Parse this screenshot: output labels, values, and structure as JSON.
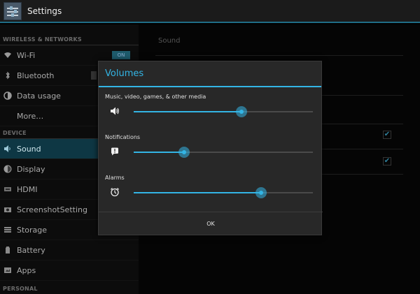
{
  "actionbar": {
    "title": "Settings",
    "icon": "settings-app-icon"
  },
  "sidebar": {
    "sections": [
      {
        "header": "WIRELESS & NETWORKS"
      },
      {
        "header": "DEVICE"
      },
      {
        "header": "PERSONAL"
      }
    ],
    "items": [
      {
        "label": "Wi-Fi",
        "icon": "wifi-icon",
        "toggle": "ON"
      },
      {
        "label": "Bluetooth",
        "icon": "bluetooth-icon",
        "toggle": ""
      },
      {
        "label": "Data usage",
        "icon": "data-usage-icon"
      },
      {
        "label": "More…"
      },
      {
        "label": "Sound",
        "icon": "speaker-icon",
        "active": true
      },
      {
        "label": "Display",
        "icon": "display-icon"
      },
      {
        "label": "HDMI",
        "icon": "hdmi-icon"
      },
      {
        "label": "ScreenshotSetting",
        "icon": "camera-icon"
      },
      {
        "label": "Storage",
        "icon": "storage-icon"
      },
      {
        "label": "Battery",
        "icon": "battery-icon"
      },
      {
        "label": "Apps",
        "icon": "apps-icon"
      }
    ]
  },
  "content": {
    "category": "Sound"
  },
  "dialog": {
    "title": "Volumes",
    "volumes": [
      {
        "label": "Music, video, games, & other media",
        "icon": "speaker-icon",
        "level": 0.6
      },
      {
        "label": "Notifications",
        "icon": "notification-icon",
        "level": 0.28
      },
      {
        "label": "Alarms",
        "icon": "alarm-clock-icon",
        "level": 0.71
      }
    ],
    "ok_label": "OK"
  },
  "colors": {
    "accent": "#33b5e5",
    "active_row": "#0e3744"
  }
}
